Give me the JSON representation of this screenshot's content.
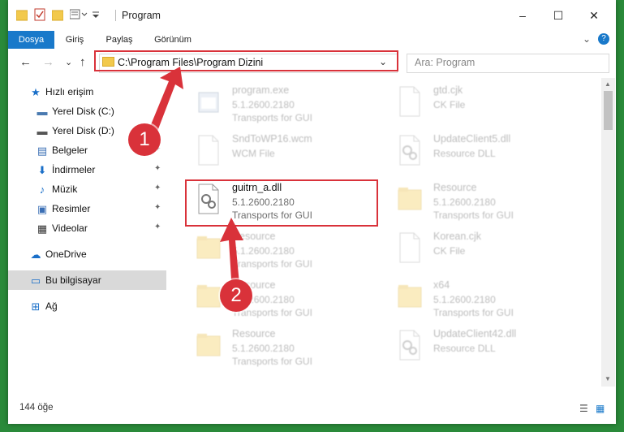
{
  "window": {
    "title": "Program",
    "min": "–",
    "max": "☐",
    "close": "✕"
  },
  "ribbon": {
    "tabs": [
      "Dosya",
      "Giriş",
      "Paylaş",
      "Görünüm"
    ],
    "collapse": "⌄",
    "help": "?"
  },
  "nav": {
    "back": "←",
    "forward": "→",
    "recent": "⌄",
    "up": "↑",
    "address": "C:\\Program Files\\Program Dizini",
    "address_chevron": "⌄",
    "refresh": "↻",
    "search_placeholder": "Ara: Program"
  },
  "sidebar": {
    "items": [
      {
        "label": "Hızlı erişim",
        "icon": "star-icon",
        "glyph": "★",
        "color": "#1a6fc8",
        "pinned": false
      },
      {
        "label": "Yerel Disk (C:)",
        "icon": "drive-icon",
        "glyph": "▬",
        "color": "#4a7ab0",
        "pinned": false
      },
      {
        "label": "Yerel Disk (D:)",
        "icon": "drive-icon",
        "glyph": "▬",
        "color": "#555555",
        "pinned": false
      },
      {
        "label": "Belgeler",
        "icon": "document-icon",
        "glyph": "▤",
        "color": "#3b6fb5",
        "pinned": true
      },
      {
        "label": "İndirmeler",
        "icon": "download-icon",
        "glyph": "⬇",
        "color": "#1a6fc8",
        "pinned": true
      },
      {
        "label": "Müzik",
        "icon": "music-icon",
        "glyph": "♪",
        "color": "#1a6fc8",
        "pinned": true
      },
      {
        "label": "Resimler",
        "icon": "picture-icon",
        "glyph": "▣",
        "color": "#3b6fb5",
        "pinned": true
      },
      {
        "label": "Videolar",
        "icon": "video-icon",
        "glyph": "▦",
        "color": "#333333",
        "pinned": true
      },
      {
        "label": "OneDrive",
        "icon": "cloud-icon",
        "glyph": "☁",
        "color": "#1a6fc8",
        "pinned": false
      },
      {
        "label": "Bu bilgisayar",
        "icon": "computer-icon",
        "glyph": "▭",
        "color": "#1a6fc8",
        "pinned": false
      },
      {
        "label": "Ağ",
        "icon": "network-icon",
        "glyph": "⊞",
        "color": "#1a6fc8",
        "pinned": false
      }
    ],
    "pin_glyph": "📌"
  },
  "files": [
    {
      "name": "program.exe",
      "line1": "5.1.2600.2180",
      "line2": "Transports for GUI",
      "icon": "exe-icon",
      "blur": true
    },
    {
      "name": "gtd.cjk",
      "line1": "CK File",
      "line2": "",
      "icon": "file-icon",
      "blur": true
    },
    {
      "name": "SndToWP16.wcm",
      "line1": "WCM File",
      "line2": "",
      "icon": "file-icon",
      "blur": true
    },
    {
      "name": "UpdateClient5.dll",
      "line1": "Resource DLL",
      "line2": "",
      "icon": "dll-icon",
      "blur": true
    },
    {
      "name": "guitrn_a.dll",
      "line1": "5.1.2600.2180",
      "line2": "Transports for GUI",
      "icon": "dll-icon",
      "blur": false
    },
    {
      "name": "Resource",
      "line1": "5.1.2600.2180",
      "line2": "Transports for GUI",
      "icon": "folder-icon",
      "blur": true
    },
    {
      "name": "Resource",
      "line1": "5.1.2600.2180",
      "line2": "Transports for GUI",
      "icon": "folder-icon",
      "blur": true
    },
    {
      "name": "Korean.cjk",
      "line1": "CK File",
      "line2": "",
      "icon": "file-icon",
      "blur": true
    },
    {
      "name": "Resource",
      "line1": "5.1.2600.2180",
      "line2": "Transports for GUI",
      "icon": "folder-icon",
      "blur": true
    },
    {
      "name": "x64",
      "line1": "5.1.2600.2180",
      "line2": "Transports for GUI",
      "icon": "folder-icon",
      "blur": true
    },
    {
      "name": "Resource",
      "line1": "5.1.2600.2180",
      "line2": "Transports for GUI",
      "icon": "folder-icon",
      "blur": true
    },
    {
      "name": "UpdateClient42.dll",
      "line1": "Resource DLL",
      "line2": "",
      "icon": "dll-icon",
      "blur": true
    }
  ],
  "status": {
    "count": "144 öğe",
    "details_view": "☰",
    "tiles_view": "▦"
  },
  "callouts": [
    "1",
    "2"
  ],
  "colors": {
    "accent": "#1979ca",
    "highlight": "#d9323a",
    "folder": "#f2c94c"
  }
}
